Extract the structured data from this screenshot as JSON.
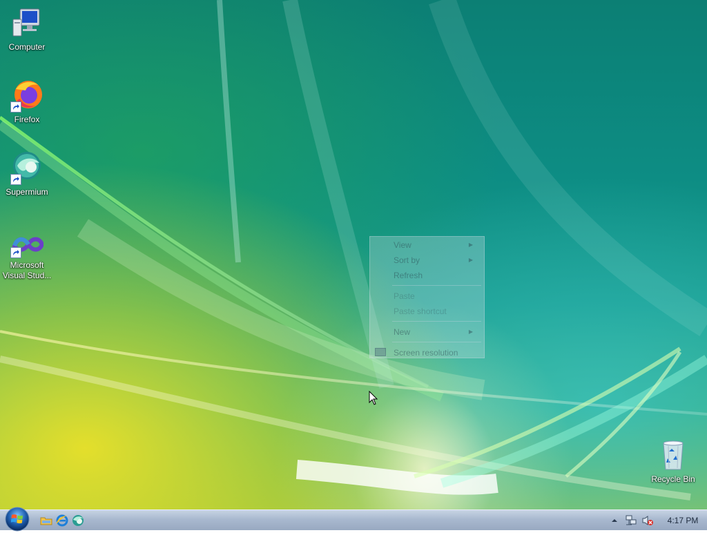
{
  "desktop": {
    "icons": [
      {
        "label_lines": [
          "Computer"
        ],
        "icon": "computer-icon",
        "shortcut": false
      },
      {
        "label_lines": [
          "Firefox"
        ],
        "icon": "firefox-icon",
        "shortcut": true
      },
      {
        "label_lines": [
          "Supermium"
        ],
        "icon": "supermium-icon",
        "shortcut": true
      },
      {
        "label_lines": [
          "Microsoft",
          "Visual Stud..."
        ],
        "icon": "visual-studio-icon",
        "shortcut": true
      },
      {
        "label_lines": [
          "Recycle Bin"
        ],
        "icon": "recycle-bin-icon",
        "shortcut": false
      }
    ]
  },
  "context_menu": {
    "items": [
      {
        "label": "View",
        "submenu": true,
        "enabled": true
      },
      {
        "label": "Sort by",
        "submenu": true,
        "enabled": true
      },
      {
        "label": "Refresh",
        "submenu": false,
        "enabled": true
      },
      {
        "label": "Paste",
        "submenu": false,
        "enabled": false
      },
      {
        "label": "Paste shortcut",
        "submenu": false,
        "enabled": false
      },
      {
        "label": "New",
        "submenu": true,
        "enabled": true
      },
      {
        "label": "Screen resolution",
        "submenu": false,
        "enabled": true,
        "icon": "display-icon"
      }
    ]
  },
  "taskbar": {
    "start_button": {
      "icon": "windows-logo-icon"
    },
    "quick_launch": [
      {
        "icon": "explorer-folder-icon"
      },
      {
        "icon": "internet-explorer-icon"
      },
      {
        "icon": "supermium-icon"
      }
    ],
    "tray": {
      "icons": [
        "show-hidden-icons-arrow",
        "network-icon",
        "volume-muted-icon"
      ],
      "clock": "4:17 PM"
    }
  },
  "colors": {
    "taskbar": "#a9b9cf",
    "desktop_base": "#0d8d84"
  }
}
